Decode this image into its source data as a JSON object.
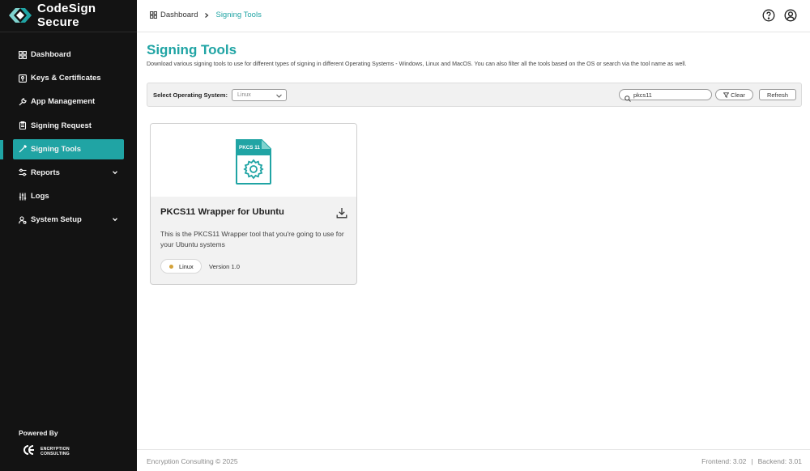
{
  "app": {
    "brand_name": "CodeSign Secure",
    "accent_color": "#20a4a4"
  },
  "sidebar": {
    "items": [
      {
        "label": "Dashboard",
        "icon": "grid-icon"
      },
      {
        "label": "Keys & Certificates",
        "icon": "key-certificate-icon"
      },
      {
        "label": "App Management",
        "icon": "wrench-icon"
      },
      {
        "label": "Signing Request",
        "icon": "clipboard-icon"
      },
      {
        "label": "Signing Tools",
        "icon": "pen-tool-icon",
        "active": true
      },
      {
        "label": "Reports",
        "icon": "settings-sliders-icon",
        "expandable": true
      },
      {
        "label": "Logs",
        "icon": "sliders-icon"
      },
      {
        "label": "System Setup",
        "icon": "user-gear-icon",
        "expandable": true
      }
    ],
    "powered_by": "Powered By",
    "powered_logo_line1": "ENCRYPTION",
    "powered_logo_line2": "CONSULTING"
  },
  "topbar": {
    "breadcrumb_home": "Dashboard",
    "breadcrumb_current": "Signing Tools"
  },
  "main": {
    "title": "Signing Tools",
    "description": "Download various signing tools to use for different types of signing in different Operating Systems - Windows, Linux and MacOS. You can also filter all the tools based on the OS or search via the tool name as well.",
    "filter": {
      "os_label": "Select Operating System:",
      "os_selected": "Linux",
      "search_value": "pkcs11",
      "clear_label": "Clear",
      "refresh_label": "Refresh"
    },
    "tools": [
      {
        "icon_label": "PKCS 11",
        "title": "PKCS11 Wrapper for Ubuntu",
        "description": "This is the PKCS11 Wrapper tool that you're going to use for your Ubuntu systems",
        "os": "Linux",
        "os_color": "#d4a23a",
        "version": "Version 1.0"
      }
    ]
  },
  "footer": {
    "copyright": "Encryption Consulting © 2025",
    "frontend": "Frontend: 3.02",
    "separator": "|",
    "backend": "Backend: 3.01"
  }
}
